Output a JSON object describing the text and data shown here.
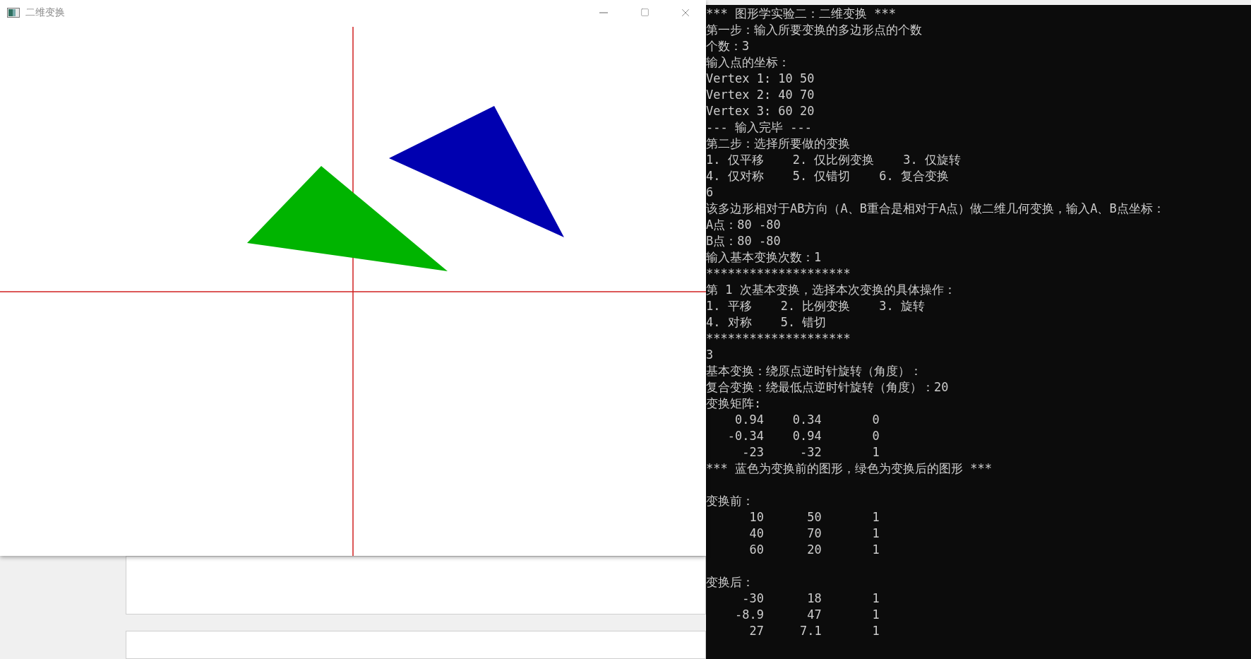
{
  "window": {
    "title": "二维变换"
  },
  "console": {
    "lines": [
      {
        "text": "*** 图形学实验二：二维变换 ***"
      },
      {
        "text": "第一步：输入所要变换的多边形点的个数"
      },
      {
        "text": "个数：3"
      },
      {
        "text": "输入点的坐标："
      },
      {
        "text": "Vertex 1: 10 50"
      },
      {
        "text": "Vertex 2: 40 70"
      },
      {
        "text": "Vertex 3: 60 20"
      },
      {
        "text": "--- 输入完毕 ---"
      },
      {
        "text": "第二步：选择所要做的变换"
      },
      {
        "text": "1. 仅平移    2. 仅比例变换    3. 仅旋转"
      },
      {
        "text": "4. 仅对称    5. 仅错切    6. 复合变换"
      },
      {
        "text": "6"
      },
      {
        "text": "该多边形相对于AB方向（A、B重合是相对于A点）做二维几何变换，输入A、B点坐标："
      },
      {
        "text": "A点：80 -80"
      },
      {
        "text": "B点：80 -80"
      },
      {
        "text": "输入基本变换次数：1"
      },
      {
        "text": "********************"
      },
      {
        "text": "第 1 次基本变换，选择本次变换的具体操作："
      },
      {
        "text": "1. 平移    2. 比例变换    3. 旋转"
      },
      {
        "text": "4. 对称    5. 错切"
      },
      {
        "text": "********************"
      },
      {
        "text": "3"
      },
      {
        "text": "基本变换：绕原点逆时针旋转（角度）："
      },
      {
        "text": "复合变换：绕最低点逆时针旋转（角度）：20"
      },
      {
        "text": "变换矩阵:"
      },
      {
        "text": "    0.94    0.34       0"
      },
      {
        "text": "   -0.34    0.94       0"
      },
      {
        "text": "     -23     -32       1"
      },
      {
        "text": "*** 蓝色为变换前的图形，绿色为变换后的图形 ***"
      },
      {
        "kind": "blank"
      },
      {
        "text": "变换前："
      },
      {
        "text": "      10      50       1"
      },
      {
        "text": "      40      70       1"
      },
      {
        "text": "      60      20       1"
      },
      {
        "kind": "blank"
      },
      {
        "text": "变换后："
      },
      {
        "text": "     -30      18       1"
      },
      {
        "text": "    -8.9      47       1"
      },
      {
        "text": "      27     7.1       1"
      }
    ]
  }
}
